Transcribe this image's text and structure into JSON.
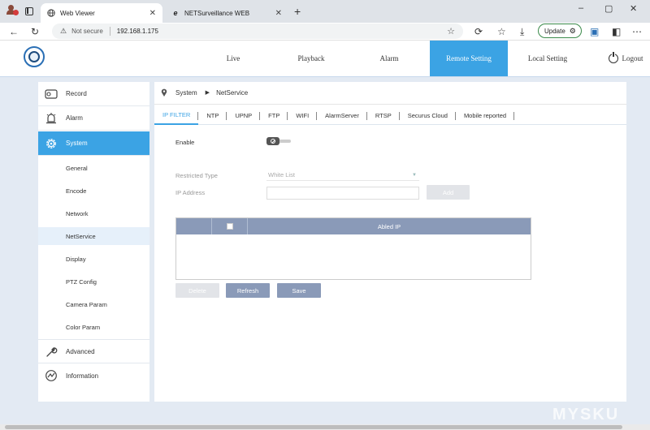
{
  "browser": {
    "tabs": [
      {
        "title": "Web Viewer",
        "active": true
      },
      {
        "title": "NETSurveillance WEB",
        "active": false
      }
    ],
    "address": {
      "security_label": "Not secure",
      "url": "192.168.1.175"
    },
    "update_label": "Update",
    "window_controls": [
      "–",
      "▢",
      "✕"
    ]
  },
  "header": {
    "nav": [
      "Live",
      "Playback",
      "Alarm",
      "Remote Setting",
      "Local Setting"
    ],
    "active_nav": "Remote Setting",
    "logout_label": "Logout"
  },
  "sidebar": {
    "items": [
      {
        "label": "Record",
        "icon": "record-icon"
      },
      {
        "label": "Alarm",
        "icon": "alarm-icon"
      },
      {
        "label": "System",
        "icon": "gear-icon",
        "active": true
      },
      {
        "label": "Advanced",
        "icon": "wrench-icon"
      },
      {
        "label": "Information",
        "icon": "info-chart-icon"
      }
    ],
    "sub_items": [
      "General",
      "Encode",
      "Network",
      "NetService",
      "Display",
      "PTZ Config",
      "Camera Param",
      "Color Param"
    ],
    "active_sub": "NetService"
  },
  "breadcrumb": {
    "first": "System",
    "second": "NetService"
  },
  "subtabs": [
    "IP FILTER",
    "NTP",
    "UPNP",
    "FTP",
    "WIFI",
    "AlarmServer",
    "RTSP",
    "Securus Cloud",
    "Mobile reported"
  ],
  "active_subtab": "IP FILTER",
  "form": {
    "enable_label": "Enable",
    "restricted_type_label": "Restricted Type",
    "restricted_type_value": "White List",
    "ip_address_label": "IP Address",
    "ip_address_value": "",
    "add_label": "Add"
  },
  "table": {
    "header": "Abled IP",
    "rows": []
  },
  "buttons": {
    "delete": "Delete",
    "refresh": "Refresh",
    "save": "Save"
  },
  "watermark": "MYSKU",
  "colors": {
    "accent": "#3ba3e4",
    "table_header": "#8a9ab8",
    "content_bg": "#e3eaf3"
  }
}
